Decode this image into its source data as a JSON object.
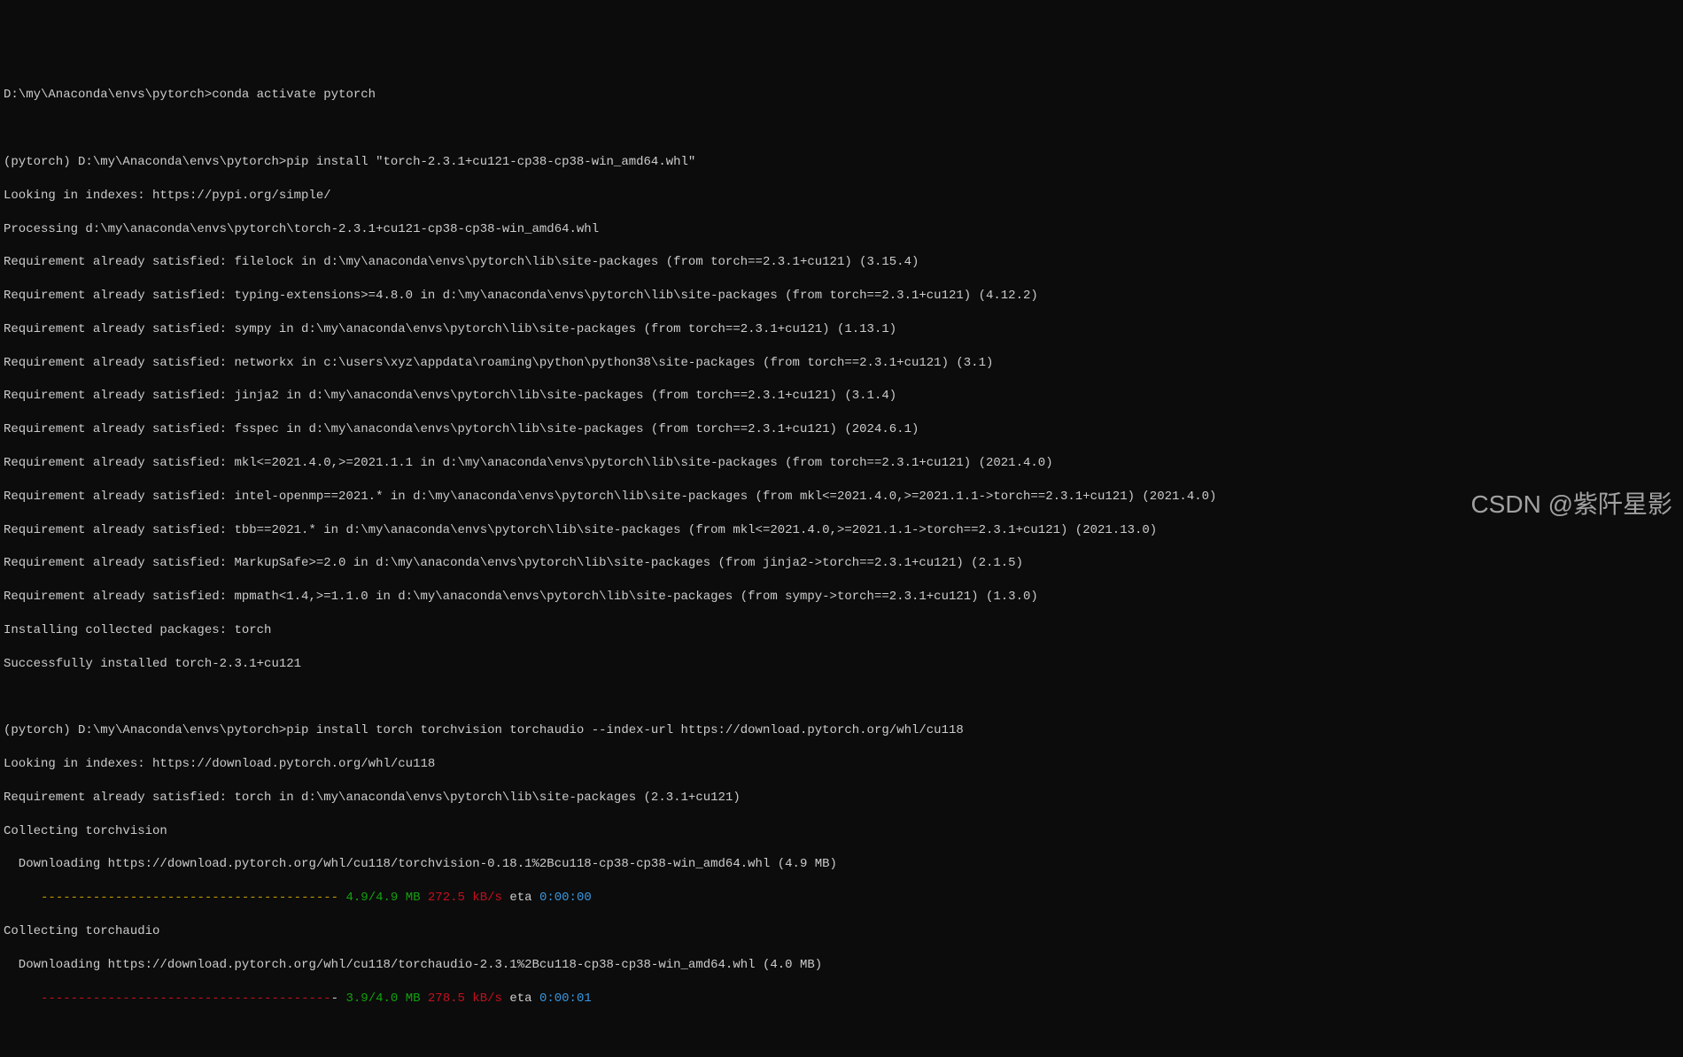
{
  "lines": {
    "l1": "D:\\my\\Anaconda\\envs\\pytorch>conda activate pytorch",
    "l2": "(pytorch) D:\\my\\Anaconda\\envs\\pytorch>pip install \"torch-2.3.1+cu121-cp38-cp38-win_amd64.whl\"",
    "l3": "Looking in indexes: https://pypi.org/simple/",
    "l4": "Processing d:\\my\\anaconda\\envs\\pytorch\\torch-2.3.1+cu121-cp38-cp38-win_amd64.whl",
    "l5": "Requirement already satisfied: filelock in d:\\my\\anaconda\\envs\\pytorch\\lib\\site-packages (from torch==2.3.1+cu121) (3.15.4)",
    "l6": "Requirement already satisfied: typing-extensions>=4.8.0 in d:\\my\\anaconda\\envs\\pytorch\\lib\\site-packages (from torch==2.3.1+cu121) (4.12.2)",
    "l7": "Requirement already satisfied: sympy in d:\\my\\anaconda\\envs\\pytorch\\lib\\site-packages (from torch==2.3.1+cu121) (1.13.1)",
    "l8": "Requirement already satisfied: networkx in c:\\users\\xyz\\appdata\\roaming\\python\\python38\\site-packages (from torch==2.3.1+cu121) (3.1)",
    "l9": "Requirement already satisfied: jinja2 in d:\\my\\anaconda\\envs\\pytorch\\lib\\site-packages (from torch==2.3.1+cu121) (3.1.4)",
    "l10": "Requirement already satisfied: fsspec in d:\\my\\anaconda\\envs\\pytorch\\lib\\site-packages (from torch==2.3.1+cu121) (2024.6.1)",
    "l11": "Requirement already satisfied: mkl<=2021.4.0,>=2021.1.1 in d:\\my\\anaconda\\envs\\pytorch\\lib\\site-packages (from torch==2.3.1+cu121) (2021.4.0)",
    "l12": "Requirement already satisfied: intel-openmp==2021.* in d:\\my\\anaconda\\envs\\pytorch\\lib\\site-packages (from mkl<=2021.4.0,>=2021.1.1->torch==2.3.1+cu121) (2021.4.0)",
    "l13": "Requirement already satisfied: tbb==2021.* in d:\\my\\anaconda\\envs\\pytorch\\lib\\site-packages (from mkl<=2021.4.0,>=2021.1.1->torch==2.3.1+cu121) (2021.13.0)",
    "l14": "Requirement already satisfied: MarkupSafe>=2.0 in d:\\my\\anaconda\\envs\\pytorch\\lib\\site-packages (from jinja2->torch==2.3.1+cu121) (2.1.5)",
    "l15": "Requirement already satisfied: mpmath<1.4,>=1.1.0 in d:\\my\\anaconda\\envs\\pytorch\\lib\\site-packages (from sympy->torch==2.3.1+cu121) (1.3.0)",
    "l16": "Installing collected packages: torch",
    "l17": "Successfully installed torch-2.3.1+cu121",
    "l18": "(pytorch) D:\\my\\Anaconda\\envs\\pytorch>pip install torch torchvision torchaudio --index-url https://download.pytorch.org/whl/cu118",
    "l19": "Looking in indexes: https://download.pytorch.org/whl/cu118",
    "l20": "Requirement already satisfied: torch in d:\\my\\anaconda\\envs\\pytorch\\lib\\site-packages (2.3.1+cu121)",
    "l21": "Collecting torchvision",
    "l22": "  Downloading https://download.pytorch.org/whl/cu118/torchvision-0.18.1%2Bcu118-cp38-cp38-win_amd64.whl (4.9 MB)",
    "l24": "Collecting torchaudio",
    "l25": "  Downloading https://download.pytorch.org/whl/cu118/torchaudio-2.3.1%2Bcu118-cp38-cp38-win_amd64.whl (4.0 MB)"
  },
  "progress1": {
    "indent": "     ",
    "dashes": "---------------------------------------- ",
    "size": "4.9/4.9 MB",
    "speed": " 272.5 kB/s",
    "eta_label": " eta ",
    "eta": "0:00:00"
  },
  "progress2": {
    "indent": "     ",
    "red_dashes": "---------------------------------------",
    "grey_dash": "- ",
    "size": "3.9/4.0 MB",
    "speed": " 278.5 kB/s",
    "eta_label": " eta ",
    "eta": "0:00:01"
  },
  "watermark": "CSDN @紫阡星影"
}
